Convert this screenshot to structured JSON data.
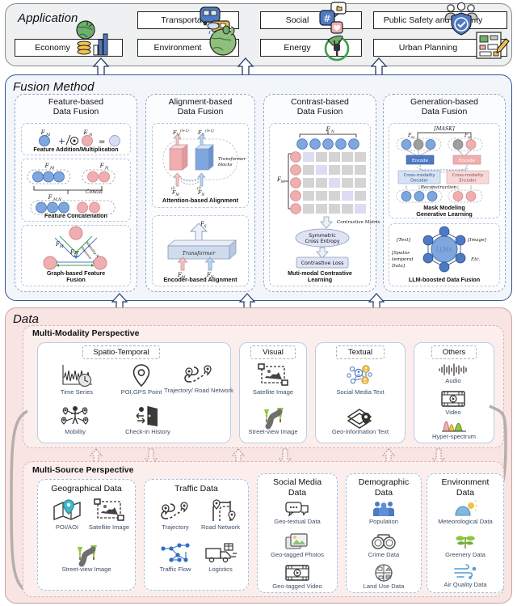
{
  "sections": {
    "application": {
      "title": "Application"
    },
    "fusion": {
      "title": "Fusion Method"
    },
    "data": {
      "title": "Data"
    }
  },
  "application": {
    "items": [
      {
        "label": "Economy",
        "icon": "globe-coins-chart-icon"
      },
      {
        "label": "Transportation",
        "icon": "train-bus-icon"
      },
      {
        "label": "Social",
        "icon": "social-hashtag-like-icon"
      },
      {
        "label": "Public Safety and Security",
        "icon": "shield-people-icon"
      },
      {
        "label": "Environment",
        "icon": "green-earth-icon"
      },
      {
        "label": "Energy",
        "icon": "leaf-plug-icon"
      },
      {
        "label": "Urban  Planning",
        "icon": "blueprint-pencil-icon"
      }
    ]
  },
  "fusion": {
    "panels": [
      {
        "title_line1": "Feature-based",
        "title_line2": "Data Fusion",
        "blocks": [
          {
            "caption": "Feature Addition/Multiplication",
            "labels": [
              "F_M",
              "E_N",
              "+",
              "⊙",
              "="
            ]
          },
          {
            "caption": "Feature Concatenation",
            "labels": [
              "F_M",
              "F_N",
              "Concat",
              "F_{M,N}"
            ]
          },
          {
            "caption_line1": "Graph-based Feature",
            "caption_line2": "Fusion",
            "labels": [
              "F_M",
              "F_N",
              "Modality N",
              "Distance"
            ]
          }
        ]
      },
      {
        "title_line1": "Alignment-based",
        "title_line2": "Data Fusion",
        "blocks": [
          {
            "caption": "Attention-based Alignment",
            "labels": [
              "F_M^{(l+1)}",
              "F_N^{(l+1)}",
              "Transformer blocks",
              "F^{(l)}_M",
              "F^{(l)}_N"
            ]
          },
          {
            "caption": "Encoder-based Alignment",
            "labels": [
              "F_S",
              "Transformer",
              "F_M",
              "F_N"
            ]
          }
        ]
      },
      {
        "title_line1": "Contrast-based",
        "title_line2": "Data Fusion",
        "blocks": [
          {
            "caption_line1": "Muti-modal Contrastive",
            "caption_line2": "Learning",
            "labels": [
              "F_N",
              "F_M",
              "Contrastive Matrix",
              "Symmetric Cross Entropy",
              "Contrastive Loss"
            ],
            "matrix_label": "Contrastive Matrix",
            "ellipse_line1": "Symmetric",
            "ellipse_line2": "Cross Entropy",
            "loss_box": "Contrastive Loss"
          }
        ]
      },
      {
        "title_line1": "Generation-based",
        "title_line2": "Data Fusion",
        "blocks": [
          {
            "caption_line1": "Mask Modeling",
            "caption_line2": "Generative Learning",
            "labels": [
              "[MASK]",
              "F_M",
              "F_N",
              "Encode",
              "Encode",
              "Cross-modality Decoder",
              "Cross-modality Encoder",
              "Reconstruction"
            ],
            "mask": "[MASK]",
            "encode_left": "Encode",
            "encode_right": "Encode",
            "decoder_left_l1": "Cross-modality",
            "decoder_left_l2": "Decoder",
            "decoder_right_l1": "Cross-modality",
            "decoder_right_l2": "Encoder",
            "reconstruction": "Reconstruction"
          },
          {
            "caption": "LLM-boosted Data Fusion",
            "center": "LLMs",
            "labels": [
              "[Text]",
              "[Image]",
              "[Spatio-temporal Data]",
              "Etc."
            ],
            "text_tl": "[Text]",
            "text_tr": "[Image]",
            "text_bl_l1": "[Spatio-",
            "text_bl_l2": "temporal",
            "text_bl_l3": "Data]",
            "text_br": "Etc."
          }
        ]
      }
    ]
  },
  "data": {
    "multi_modality": {
      "title": "Multi-Modality Perspective",
      "cards": [
        {
          "header": "Spatio-Temporal",
          "items": [
            {
              "label": "Time Series",
              "icon": "timeseries-clock-icon"
            },
            {
              "label": "POI,GPS Point",
              "icon": "map-pin-icon"
            },
            {
              "label": "Trajectory/ Road Network",
              "icon": "trajectory-icon"
            },
            {
              "label": "Mobility",
              "icon": "mobility-people-icon"
            },
            {
              "label": "Check-in History",
              "icon": "checkin-door-icon"
            }
          ]
        },
        {
          "header": "Visual",
          "items": [
            {
              "label": "Satellite Image",
              "icon": "satellite-image-icon"
            },
            {
              "label": "Street-view Image",
              "icon": "street-view-icon"
            }
          ]
        },
        {
          "header": "Textual",
          "items": [
            {
              "label": "Social Media Text",
              "icon": "social-network-icon"
            },
            {
              "label": "Geo-information Text",
              "icon": "geo-layers-pin-icon"
            }
          ]
        },
        {
          "header": "Others",
          "items": [
            {
              "label": "Audio",
              "icon": "audio-wave-icon"
            },
            {
              "label": "Video",
              "icon": "video-play-icon"
            },
            {
              "label": "Hyper-spectrum",
              "icon": "spectrum-curves-icon"
            }
          ]
        }
      ]
    },
    "multi_source": {
      "title": "Multi-Source Perspective",
      "cards": [
        {
          "header": "Geographical Data",
          "items": [
            {
              "label": "POI/AOI",
              "icon": "folded-map-pin-icon"
            },
            {
              "label": "Satellite Image",
              "icon": "satellite-image-icon"
            },
            {
              "label": "Street-view Image",
              "icon": "street-view-icon"
            }
          ]
        },
        {
          "header": "Traffic Data",
          "items": [
            {
              "label": "Trajectory",
              "icon": "trajectory-icon"
            },
            {
              "label": "Road Network",
              "icon": "road-network-icon"
            },
            {
              "label": "Traffic Flow",
              "icon": "traffic-flow-graph-icon"
            },
            {
              "label": "Logistics",
              "icon": "truck-box-icon"
            }
          ]
        },
        {
          "header_line1": "Social Media",
          "header_line2": "Data",
          "items": [
            {
              "label": "Geo-textual Data",
              "icon": "chat-bubbles-icon"
            },
            {
              "label": "Geo-tagged Photos",
              "icon": "photos-icon"
            },
            {
              "label": "Geo-tagged Video",
              "icon": "video-play-icon"
            }
          ]
        },
        {
          "header_line1": "Demographic",
          "header_line2": "Data",
          "items": [
            {
              "label": "Population",
              "icon": "people-group-icon"
            },
            {
              "label": "Crime Data",
              "icon": "handcuffs-icon"
            },
            {
              "label": "Land Use Data",
              "icon": "land-use-grid-icon"
            }
          ]
        },
        {
          "header_line1": "Environment",
          "header_line2": "Data",
          "items": [
            {
              "label": "Meteorological Data",
              "icon": "sun-cloud-icon"
            },
            {
              "label": "Greenery Data",
              "icon": "leaf-branch-icon"
            },
            {
              "label": "Air Quality Data",
              "icon": "wind-air-icon"
            }
          ]
        }
      ]
    }
  },
  "colors": {
    "application_bg": "#eef0f2",
    "fusion_bg": "#f2f5fa",
    "fusion_border": "#2f5597",
    "data_bg": "#f8e4e2",
    "data_border": "#c9a3a0",
    "blue_node": "#7fa7dd",
    "pink_node": "#f0aeb0",
    "label_text": "#3d4f66"
  }
}
